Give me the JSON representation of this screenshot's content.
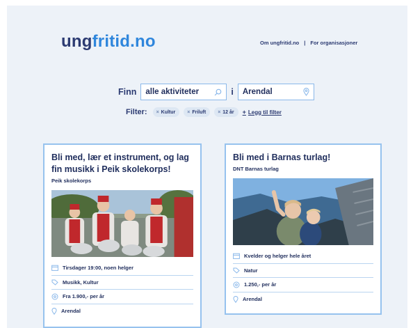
{
  "header": {
    "logo_part1": "ung",
    "logo_part2": "fritid.no",
    "nav": {
      "about": "Om ungfritid.no",
      "separator": "|",
      "orgs": "For organisasjoner"
    }
  },
  "search": {
    "find_label": "Finn",
    "activity_value": "alle aktiviteter",
    "in_label": "i",
    "place_value": "Arendal"
  },
  "filters": {
    "label": "Filter:",
    "chips": [
      "Kultur",
      "Friluft",
      "12 år"
    ],
    "remove_symbol": "×",
    "add_symbol": "+",
    "add_label": "Legg til filter"
  },
  "cards": [
    {
      "title": "Bli med, lær et instrument, og lag fin musikk i Peik skolekorps!",
      "organizer": "Peik skolekorps",
      "schedule": "Tirsdager 19:00, noen helger",
      "categories": "Musikk, Kultur",
      "price": "Fra 1.900,- per år",
      "location": "Arendal"
    },
    {
      "title": "Bli med i Barnas turlag!",
      "organizer": "DNT Barnas turlag",
      "schedule": "Kvelder og helger hele året",
      "categories": "Natur",
      "price": "1.250,- per år",
      "location": "Arendal"
    }
  ],
  "icons": {
    "search": "search-icon",
    "location": "location-pin-icon",
    "calendar": "calendar-icon",
    "tag": "tag-icon",
    "price": "price-icon"
  },
  "colors": {
    "background": "#edf2f8",
    "navy": "#2c3b72",
    "accent_blue": "#2f86dc",
    "card_border": "#96c2ee"
  }
}
